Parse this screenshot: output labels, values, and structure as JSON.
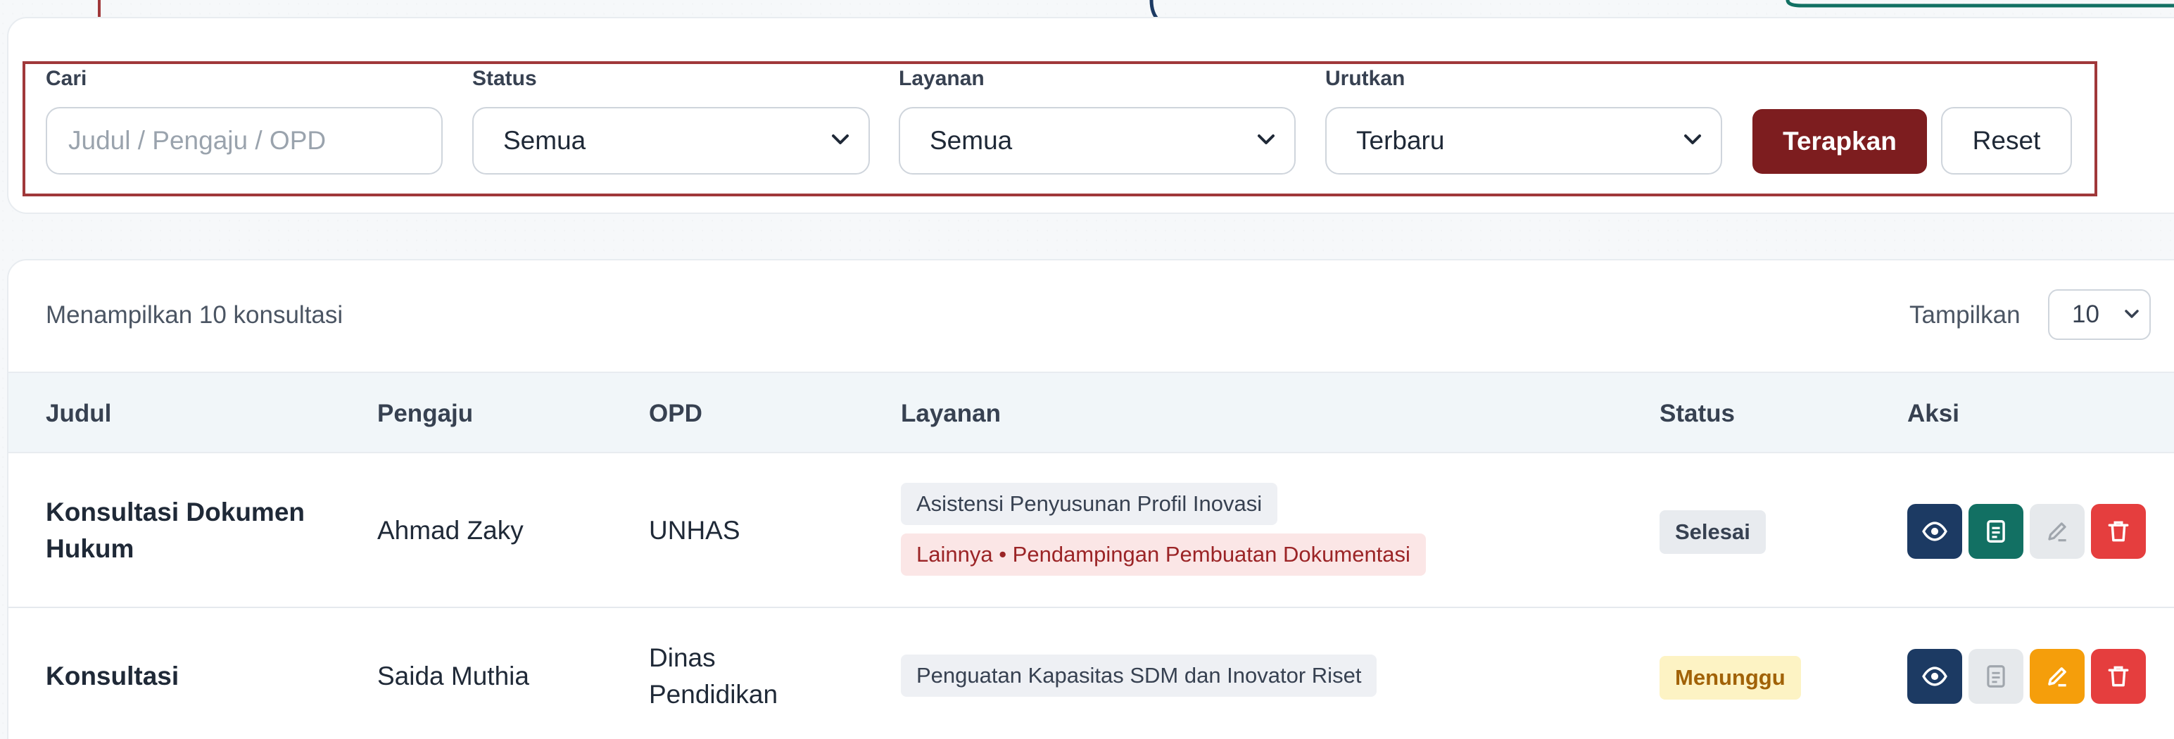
{
  "filters": {
    "search": {
      "label": "Cari",
      "placeholder": "Judul / Pengaju / OPD"
    },
    "status": {
      "label": "Status",
      "value": "Semua"
    },
    "service": {
      "label": "Layanan",
      "value": "Semua"
    },
    "sort": {
      "label": "Urutkan",
      "value": "Terbaru"
    },
    "apply_label": "Terapkan",
    "reset_label": "Reset"
  },
  "table": {
    "summary": "Menampilkan 10 konsultasi",
    "per_page_label": "Tampilkan",
    "per_page_value": "10",
    "columns": [
      "Judul",
      "Pengaju",
      "OPD",
      "Layanan",
      "Status",
      "Aksi"
    ],
    "rows": [
      {
        "title": "Konsultasi Dokumen Hukum",
        "applicant": "Ahmad Zaky",
        "opd": "UNHAS",
        "services": [
          "Asistensi Penyusunan Profil Inovasi",
          "Lainnya • Pendampingan Pembuatan Dokumentasi"
        ],
        "status": "Selesai"
      },
      {
        "title": "Konsultasi",
        "applicant": "Saida Muthia",
        "opd": "Dinas Pendidikan",
        "services": [
          "Penguatan Kapasitas SDM dan Inovator Riset"
        ],
        "status": "Menunggu"
      }
    ]
  },
  "colors": {
    "primary": "#7d1d1f",
    "navy": "#1c3a63",
    "teal": "#127063",
    "amber": "#f59e0b",
    "danger": "#e53e3e",
    "callout_red": "#a0383a"
  },
  "icons": [
    "chevron-down-icon",
    "eye-icon",
    "document-icon",
    "pencil-icon",
    "trash-icon"
  ]
}
